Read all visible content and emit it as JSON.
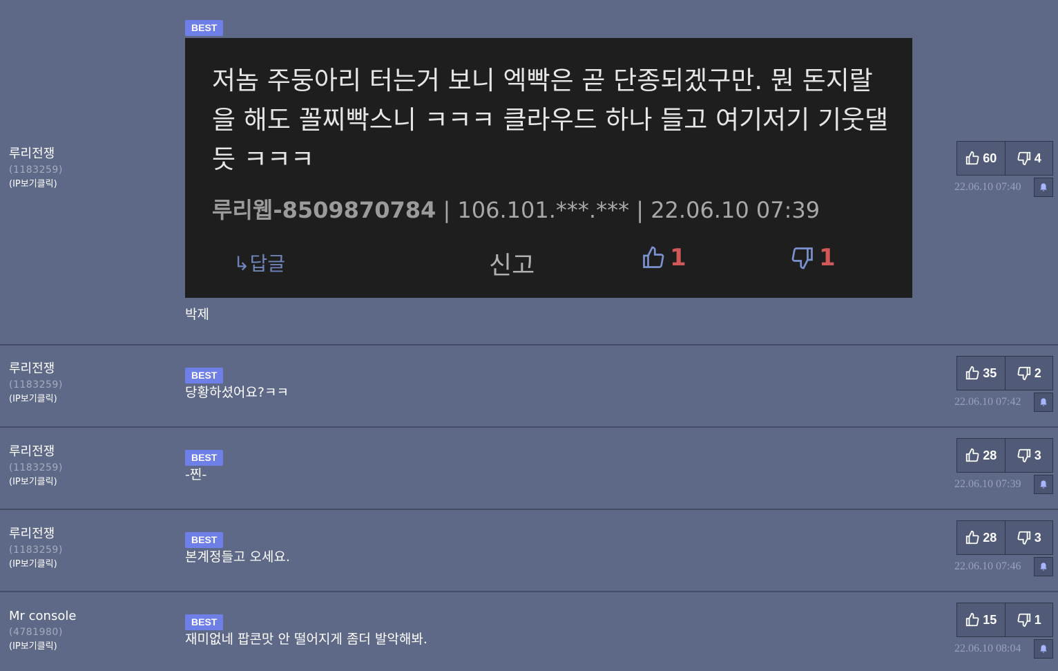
{
  "comments": [
    {
      "author": "루리전쟁",
      "user_id": "(1183259)",
      "ip_label": "(IP보기클릭)",
      "badge": "BEST",
      "text": "박제",
      "up": "60",
      "down": "4",
      "time": "22.06.10 07:40",
      "screenshot": {
        "text": "저놈 주둥아리 터는거 보니 엑빡은 곧 단종되겠구만. 뭔 돈지랄을 해도 꼴찌빡스니 ㅋㅋㅋ 클라우드 하나 들고 여기저기 기웃댈듯 ㅋㅋㅋ",
        "nick": "루리웹-8509870784",
        "meta": " | 106.101.***.*** | 22.06.10 07:39",
        "reply": "↳답글",
        "report": "신고",
        "up": "1",
        "down": "1"
      }
    },
    {
      "author": "루리전쟁",
      "user_id": "(1183259)",
      "ip_label": "(IP보기클릭)",
      "badge": "BEST",
      "text": "당황하셨어요?ㅋㅋ",
      "up": "35",
      "down": "2",
      "time": "22.06.10 07:42"
    },
    {
      "author": "루리전쟁",
      "user_id": "(1183259)",
      "ip_label": "(IP보기클릭)",
      "badge": "BEST",
      "text": "-찐-",
      "up": "28",
      "down": "3",
      "time": "22.06.10 07:39"
    },
    {
      "author": "루리전쟁",
      "user_id": "(1183259)",
      "ip_label": "(IP보기클릭)",
      "badge": "BEST",
      "text": "본계정들고 오세요.",
      "up": "28",
      "down": "3",
      "time": "22.06.10 07:46"
    },
    {
      "author": "Mr console",
      "user_id": "(4781980)",
      "ip_label": "(IP보기클릭)",
      "badge": "BEST",
      "text": "재미없네 팝콘맛 안 떨어지게 좀더 발악해봐.",
      "up": "15",
      "down": "1",
      "time": "22.06.10 08:04"
    }
  ],
  "icons": {
    "up": "thumbs-up-icon",
    "down": "thumbs-down-icon",
    "report": "bell-icon"
  },
  "colors": {
    "background": "#5e6987",
    "badge": "#6f7fe8",
    "timestamp": "#9aa2ba",
    "screenshot_bg": "#1e1e1e",
    "vote_red": "#d15858"
  }
}
